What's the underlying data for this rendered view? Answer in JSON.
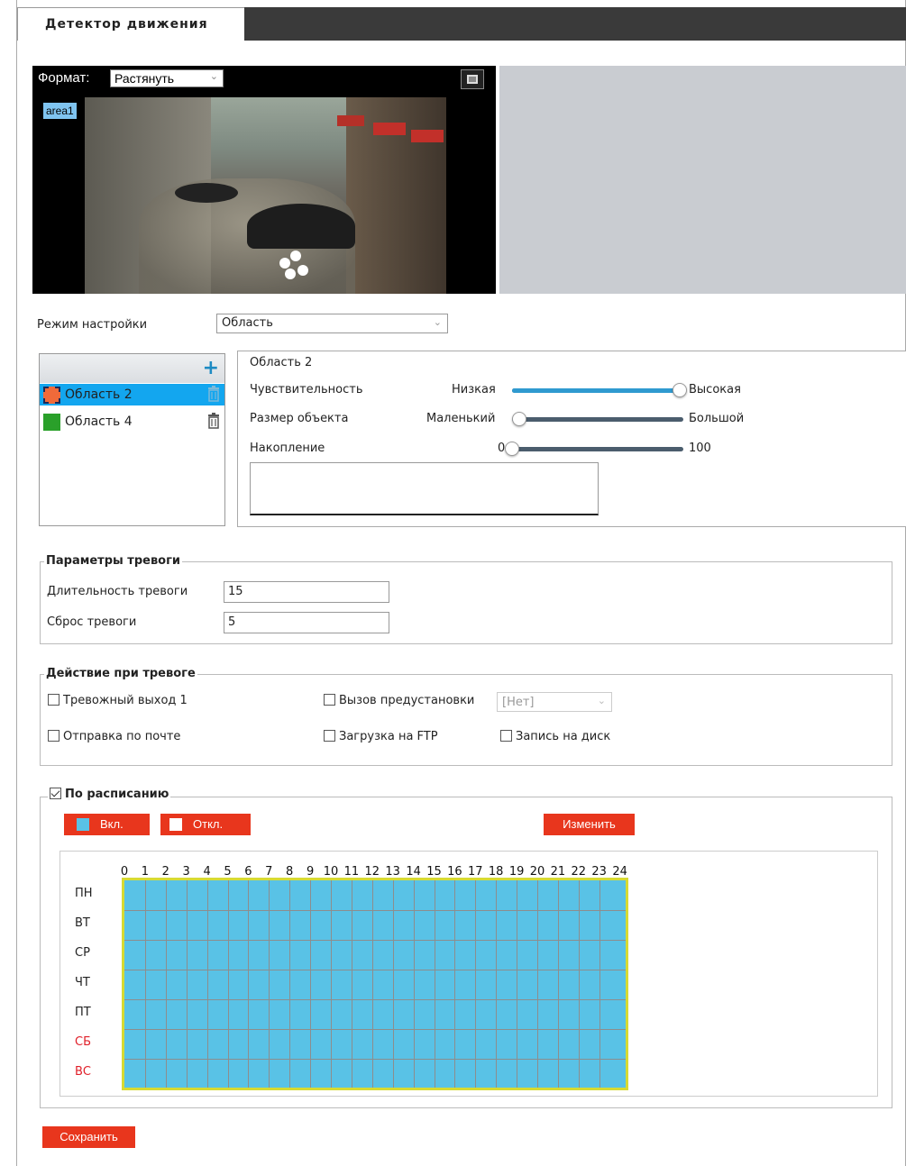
{
  "header": {
    "tab_title": "Детектор движения"
  },
  "video": {
    "format_label": "Формат:",
    "format_value": "Растянуть",
    "area_tag": "area1"
  },
  "setup_mode": {
    "label": "Режим настройки",
    "value": "Область"
  },
  "areas": {
    "items": [
      {
        "name": "Область 2",
        "color": "#f06a3a",
        "selected": true
      },
      {
        "name": "Область 4",
        "color": "#2aa02a",
        "selected": false
      }
    ]
  },
  "area_props": {
    "title": "Область 2",
    "sensitivity": {
      "label": "Чувствительность",
      "min_label": "Низкая",
      "max_label": "Высокая",
      "value_fraction": 0.98
    },
    "object_size": {
      "label": "Размер объекта",
      "min_label": "Маленький",
      "max_label": "Большой",
      "value_fraction": 0.04
    },
    "accumulation": {
      "label": "Накопление",
      "min_label": "0",
      "max_label": "100",
      "value_fraction": 0.0
    }
  },
  "alarm_params": {
    "legend": "Параметры тревоги",
    "duration_label": "Длительность тревоги",
    "duration_value": "15",
    "reset_label": "Сброс тревоги",
    "reset_value": "5"
  },
  "alarm_actions": {
    "legend": "Действие при тревоге",
    "alarm_output": "Тревожный выход 1",
    "preset_call": "Вызов предустановки",
    "preset_value": "[Нет]",
    "send_mail": "Отправка по почте",
    "ftp_upload": "Загрузка на FTP",
    "disk_record": "Запись на диск"
  },
  "schedule": {
    "legend": "По расписанию",
    "enabled": true,
    "on_label": "Вкл.",
    "off_label": "Откл.",
    "edit_label": "Изменить",
    "hours": [
      "0",
      "1",
      "2",
      "3",
      "4",
      "5",
      "6",
      "7",
      "8",
      "9",
      "10",
      "11",
      "12",
      "13",
      "14",
      "15",
      "16",
      "17",
      "18",
      "19",
      "20",
      "21",
      "22",
      "23",
      "24"
    ],
    "days": [
      {
        "label": "ПН",
        "weekend": false
      },
      {
        "label": "ВТ",
        "weekend": false
      },
      {
        "label": "СР",
        "weekend": false
      },
      {
        "label": "ЧТ",
        "weekend": false
      },
      {
        "label": "ПТ",
        "weekend": false
      },
      {
        "label": "СБ",
        "weekend": true
      },
      {
        "label": "ВС",
        "weekend": true
      }
    ],
    "active_color": "#59c2e6",
    "border_color": "#d7da33"
  },
  "footer": {
    "save_label": "Сохранить"
  },
  "colors": {
    "accent_red": "#e8361d",
    "selection_blue": "#13a6ef"
  }
}
